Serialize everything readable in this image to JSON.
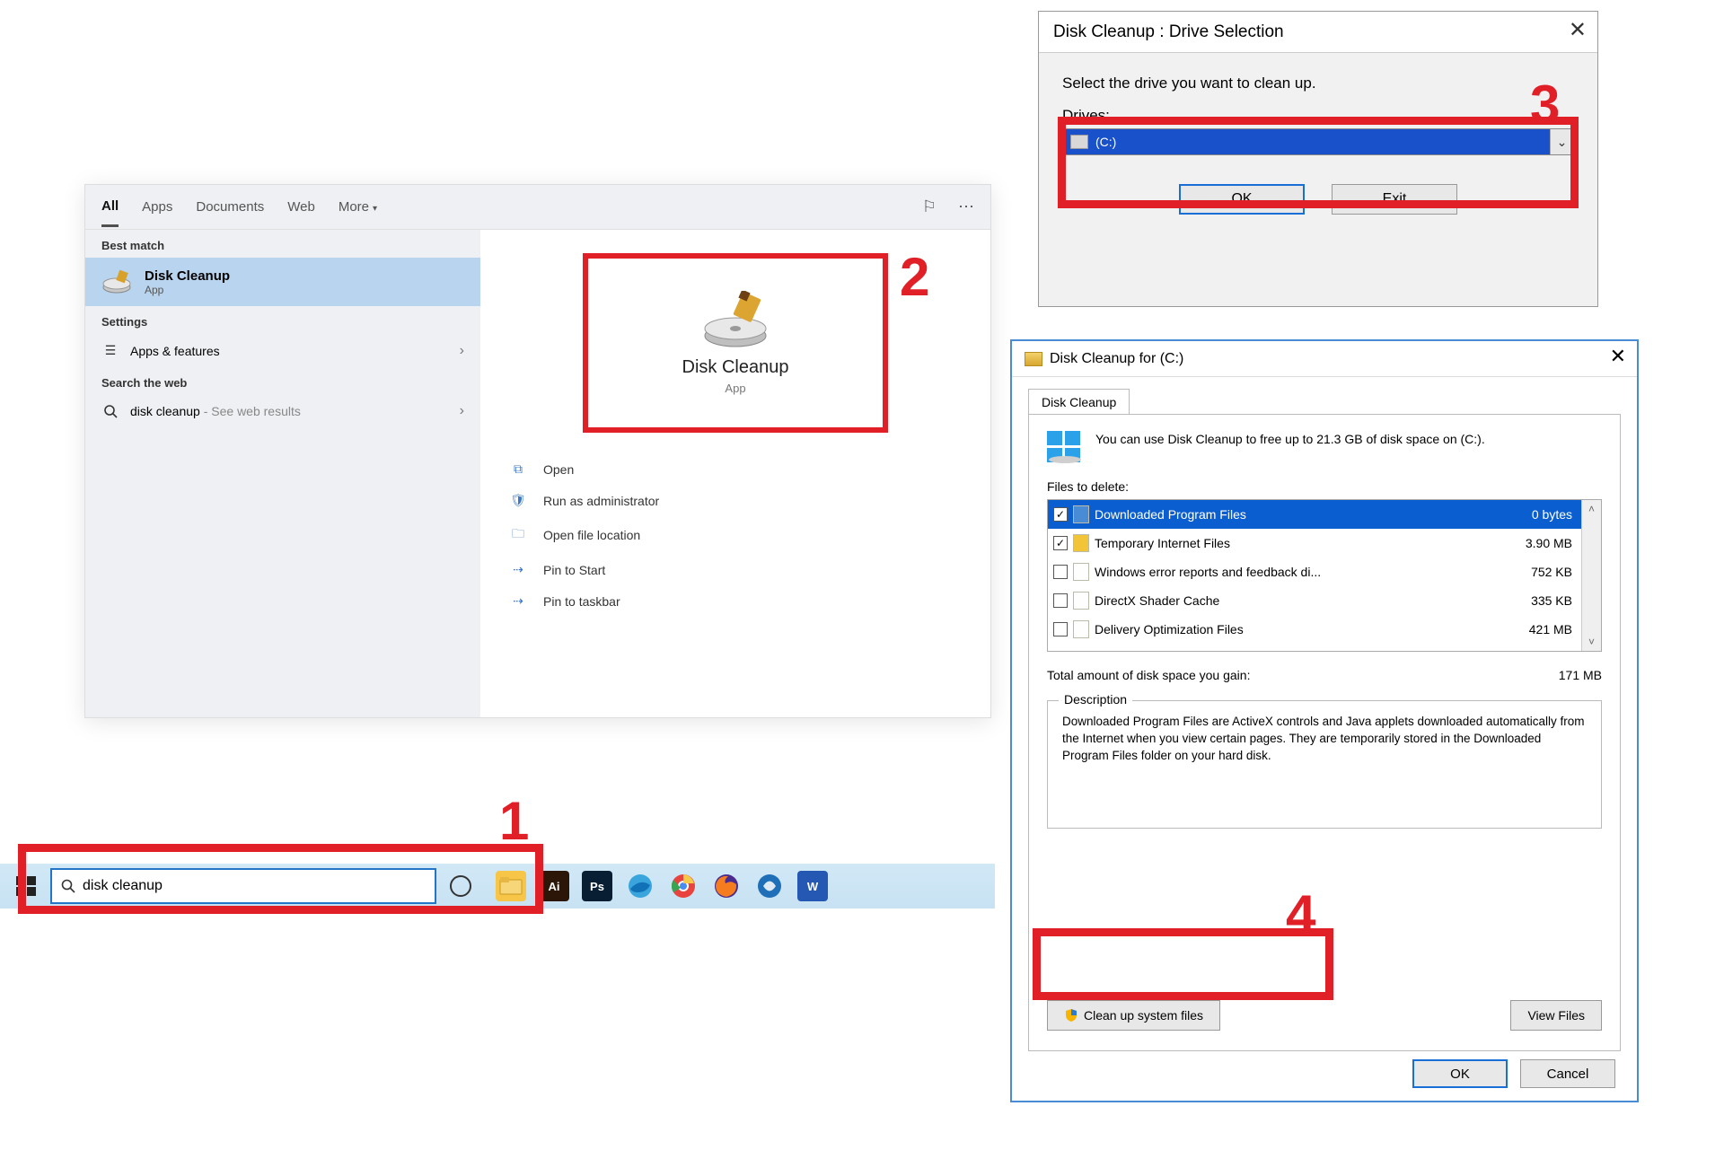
{
  "search": {
    "tabs": {
      "all": "All",
      "apps": "Apps",
      "documents": "Documents",
      "web": "Web",
      "more": "More"
    },
    "groups": {
      "best_match": "Best match",
      "settings": "Settings",
      "search_web": "Search the web"
    },
    "best": {
      "title": "Disk Cleanup",
      "sub": "App"
    },
    "settings_item": "Apps & features",
    "web_item_query": "disk cleanup",
    "web_item_suffix": " - See web results",
    "preview": {
      "title": "Disk Cleanup",
      "sub": "App"
    },
    "actions": {
      "open": "Open",
      "run_admin": "Run as administrator",
      "open_loc": "Open file location",
      "pin_start": "Pin to Start",
      "pin_taskbar": "Pin to taskbar"
    }
  },
  "taskbar": {
    "search_value": "disk cleanup"
  },
  "annotations": {
    "n1": "1",
    "n2": "2",
    "n3": "3",
    "n4": "4"
  },
  "drive_dialog": {
    "title": "Disk Cleanup : Drive Selection",
    "prompt": "Select the drive you want to clean up.",
    "label": "Drives:",
    "selected": "(C:)",
    "ok": "OK",
    "exit": "Exit"
  },
  "cleanup": {
    "title": "Disk Cleanup for  (C:)",
    "tab": "Disk Cleanup",
    "intro": "You can use Disk Cleanup to free up to 21.3 GB of disk space on  (C:).",
    "files_label": "Files to delete:",
    "rows": [
      {
        "checked": true,
        "name": "Downloaded Program Files",
        "size": "0 bytes"
      },
      {
        "checked": true,
        "name": "Temporary Internet Files",
        "size": "3.90 MB"
      },
      {
        "checked": false,
        "name": "Windows error reports and feedback di...",
        "size": "752 KB"
      },
      {
        "checked": false,
        "name": "DirectX Shader Cache",
        "size": "335 KB"
      },
      {
        "checked": false,
        "name": "Delivery Optimization Files",
        "size": "421 MB"
      }
    ],
    "total_label": "Total amount of disk space you gain:",
    "total_value": "171 MB",
    "desc_title": "Description",
    "desc_text": "Downloaded Program Files are ActiveX controls and Java applets downloaded automatically from the Internet when you view certain pages. They are temporarily stored in the Downloaded Program Files folder on your hard disk.",
    "clean_sys": "Clean up system files",
    "view_files": "View Files",
    "ok": "OK",
    "cancel": "Cancel"
  }
}
